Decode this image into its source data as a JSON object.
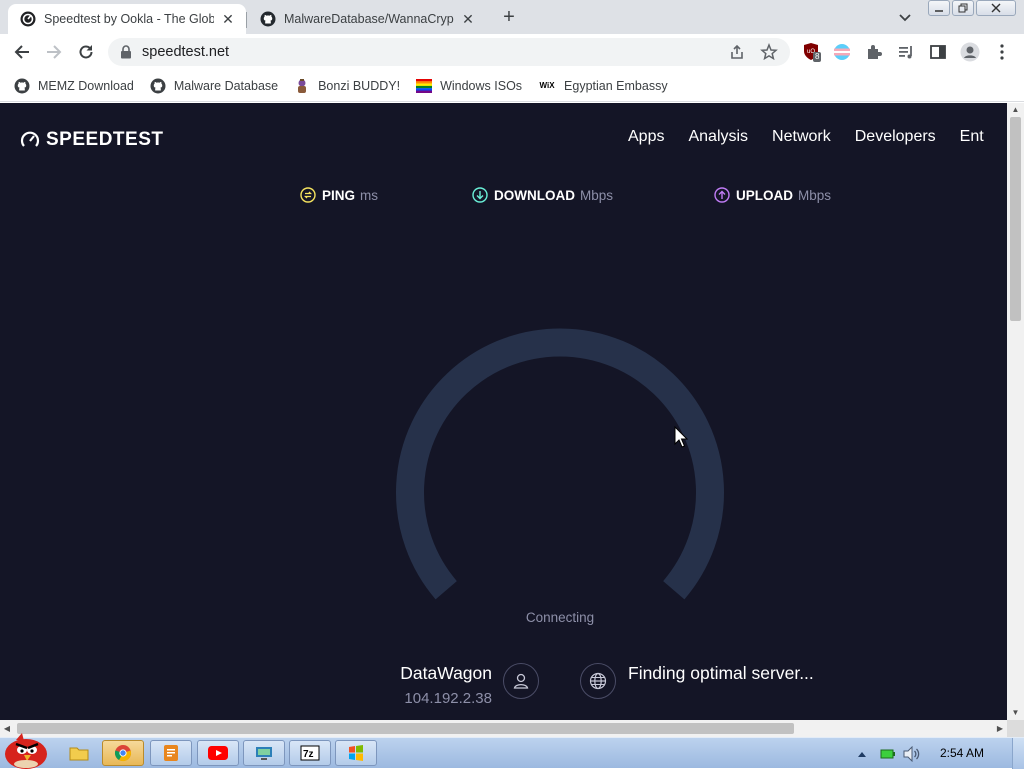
{
  "browser": {
    "tabs": [
      {
        "title": "Speedtest by Ookla - The Glob",
        "active": true
      },
      {
        "title": "MalwareDatabase/WannaCryp",
        "active": false
      }
    ],
    "new_tab": "+",
    "url": "speedtest.net",
    "bookmarks": [
      {
        "label": "MEMZ Download",
        "icon": "github-icon"
      },
      {
        "label": "Malware Database",
        "icon": "github-icon"
      },
      {
        "label": "Bonzi BUDDY!",
        "icon": "bonzi-icon"
      },
      {
        "label": "Windows ISOs",
        "icon": "rainbow-flag-icon"
      },
      {
        "label": "Egyptian Embassy",
        "icon": "wix-icon",
        "icon_text": "WiX"
      }
    ],
    "extension_badge": "8"
  },
  "page": {
    "logo": "SPEEDTEST",
    "nav": [
      "Apps",
      "Analysis",
      "Network",
      "Developers",
      "Ent"
    ],
    "metrics": [
      {
        "label": "PING",
        "unit": "ms",
        "color": "#f5e35f"
      },
      {
        "label": "DOWNLOAD",
        "unit": "Mbps",
        "color": "#6af0d8"
      },
      {
        "label": "UPLOAD",
        "unit": "Mbps",
        "color": "#c07cf5"
      }
    ],
    "status": "Connecting",
    "isp": {
      "name": "DataWagon",
      "ip": "104.192.2.38"
    },
    "server": {
      "status": "Finding optimal server..."
    },
    "colors": {
      "background": "#141526",
      "gauge": "#26314a"
    }
  },
  "taskbar": {
    "clock": "2:54 AM",
    "apps": [
      "explorer",
      "chrome",
      "app-orange",
      "youtube",
      "network-app",
      "7zip",
      "windows-xp"
    ]
  }
}
